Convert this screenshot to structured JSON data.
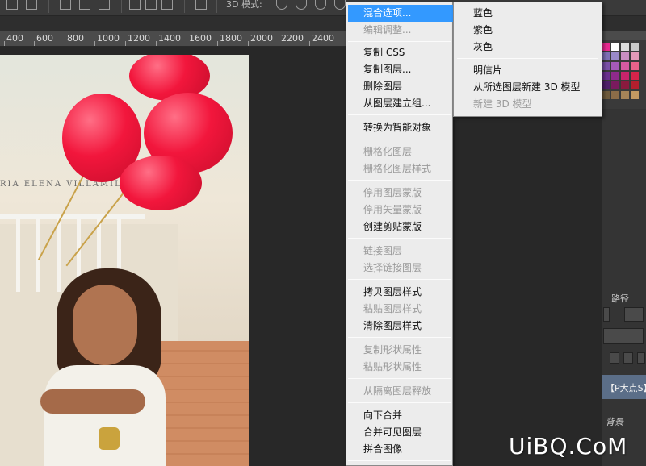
{
  "options_bar": {
    "mode_label": "3D 模式:"
  },
  "ruler": {
    "labels": [
      "400",
      "600",
      "800",
      "1000",
      "1200",
      "1400",
      "1600",
      "1800",
      "2000",
      "2200",
      "2400"
    ]
  },
  "photo": {
    "sign_text": "RIA ELENA VILLAMIL"
  },
  "context_menu": {
    "items": [
      {
        "label": "混合选项...",
        "state": "selected"
      },
      {
        "label": "编辑调整...",
        "state": "disabled"
      },
      {
        "label": "复制 CSS",
        "state": "enabled"
      },
      {
        "label": "复制图层...",
        "state": "enabled"
      },
      {
        "label": "删除图层",
        "state": "enabled"
      },
      {
        "label": "从图层建立组...",
        "state": "enabled"
      },
      {
        "label": "转换为智能对象",
        "state": "enabled"
      },
      {
        "label": "栅格化图层",
        "state": "disabled"
      },
      {
        "label": "栅格化图层样式",
        "state": "disabled"
      },
      {
        "label": "停用图层蒙版",
        "state": "disabled"
      },
      {
        "label": "停用矢量蒙版",
        "state": "disabled"
      },
      {
        "label": "创建剪贴蒙版",
        "state": "enabled"
      },
      {
        "label": "链接图层",
        "state": "disabled"
      },
      {
        "label": "选择链接图层",
        "state": "disabled"
      },
      {
        "label": "拷贝图层样式",
        "state": "enabled"
      },
      {
        "label": "粘贴图层样式",
        "state": "disabled"
      },
      {
        "label": "清除图层样式",
        "state": "enabled"
      },
      {
        "label": "复制形状属性",
        "state": "disabled"
      },
      {
        "label": "粘贴形状属性",
        "state": "disabled"
      },
      {
        "label": "从隔离图层释放",
        "state": "disabled"
      },
      {
        "label": "向下合并",
        "state": "enabled"
      },
      {
        "label": "合并可见图层",
        "state": "enabled"
      },
      {
        "label": "拼合图像",
        "state": "enabled"
      }
    ]
  },
  "submenu": {
    "items": [
      {
        "label": "蓝色",
        "state": "enabled"
      },
      {
        "label": "紫色",
        "state": "enabled"
      },
      {
        "label": "灰色",
        "state": "enabled"
      },
      {
        "label": "明信片",
        "state": "enabled"
      },
      {
        "label": "从所选图层新建 3D 模型",
        "state": "enabled"
      },
      {
        "label": "新建 3D 模型",
        "state": "disabled"
      }
    ]
  },
  "panels": {
    "paths_tab": "路径",
    "layer_name": "【P大点S】",
    "background_label": "背景"
  },
  "watermark": "UiBQ.CoM",
  "colors": {
    "menu_bg": "#ececec",
    "menu_highlight": "#3399ff",
    "menu_disabled": "#9a9a9a",
    "ui_dark": "#282828",
    "ruler": "#4b4b4b",
    "layer_selected": "#5b6e88"
  }
}
